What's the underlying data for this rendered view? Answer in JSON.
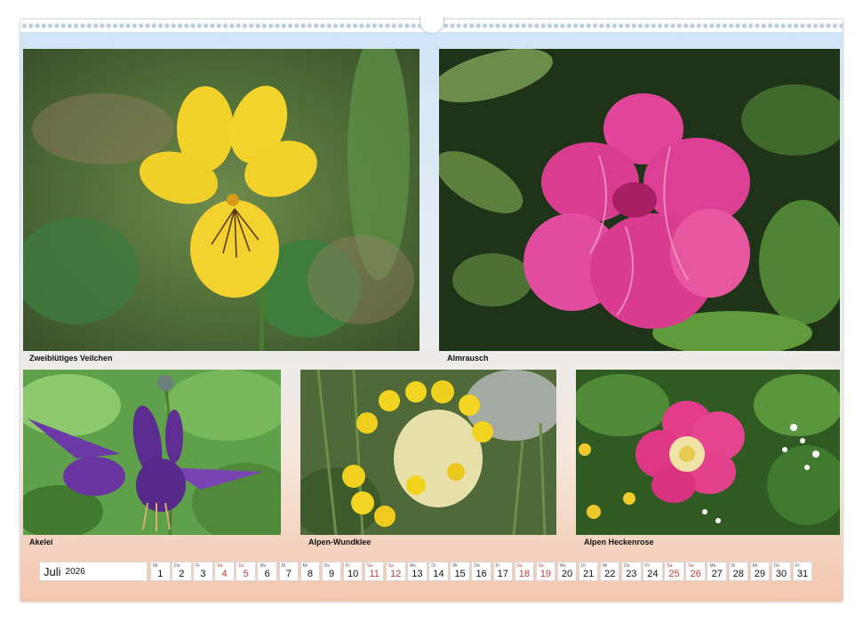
{
  "photos": [
    {
      "id": "zweibluetiges-veilchen",
      "caption": "Zweiblütiges Veilchen"
    },
    {
      "id": "almrausch",
      "caption": "Almrausch"
    },
    {
      "id": "akelei",
      "caption": "Akelei"
    },
    {
      "id": "alpen-wundklee",
      "caption": "Alpen-Wundklee"
    },
    {
      "id": "alpen-heckenrose",
      "caption": "Alpen Heckenrose"
    }
  ],
  "calendar": {
    "month": "Juli",
    "year": "2026",
    "days": [
      {
        "dow": "Mi",
        "num": "1"
      },
      {
        "dow": "Do",
        "num": "2"
      },
      {
        "dow": "Fr",
        "num": "3"
      },
      {
        "dow": "Sa",
        "num": "4"
      },
      {
        "dow": "So",
        "num": "5"
      },
      {
        "dow": "Mo",
        "num": "6"
      },
      {
        "dow": "Di",
        "num": "7"
      },
      {
        "dow": "Mi",
        "num": "8"
      },
      {
        "dow": "Do",
        "num": "9"
      },
      {
        "dow": "Fr",
        "num": "10"
      },
      {
        "dow": "Sa",
        "num": "11"
      },
      {
        "dow": "So",
        "num": "12"
      },
      {
        "dow": "Mo",
        "num": "13"
      },
      {
        "dow": "Di",
        "num": "14"
      },
      {
        "dow": "Mi",
        "num": "15"
      },
      {
        "dow": "Do",
        "num": "16"
      },
      {
        "dow": "Fr",
        "num": "17"
      },
      {
        "dow": "Sa",
        "num": "18"
      },
      {
        "dow": "So",
        "num": "19"
      },
      {
        "dow": "Mo",
        "num": "20"
      },
      {
        "dow": "Di",
        "num": "21"
      },
      {
        "dow": "Mi",
        "num": "22"
      },
      {
        "dow": "Do",
        "num": "23"
      },
      {
        "dow": "Fr",
        "num": "24"
      },
      {
        "dow": "Sa",
        "num": "25"
      },
      {
        "dow": "So",
        "num": "26"
      },
      {
        "dow": "Mo",
        "num": "27"
      },
      {
        "dow": "Di",
        "num": "28"
      },
      {
        "dow": "Mi",
        "num": "29"
      },
      {
        "dow": "Do",
        "num": "30"
      },
      {
        "dow": "Fr",
        "num": "31"
      }
    ],
    "weekend_color": "#c43a3a"
  }
}
